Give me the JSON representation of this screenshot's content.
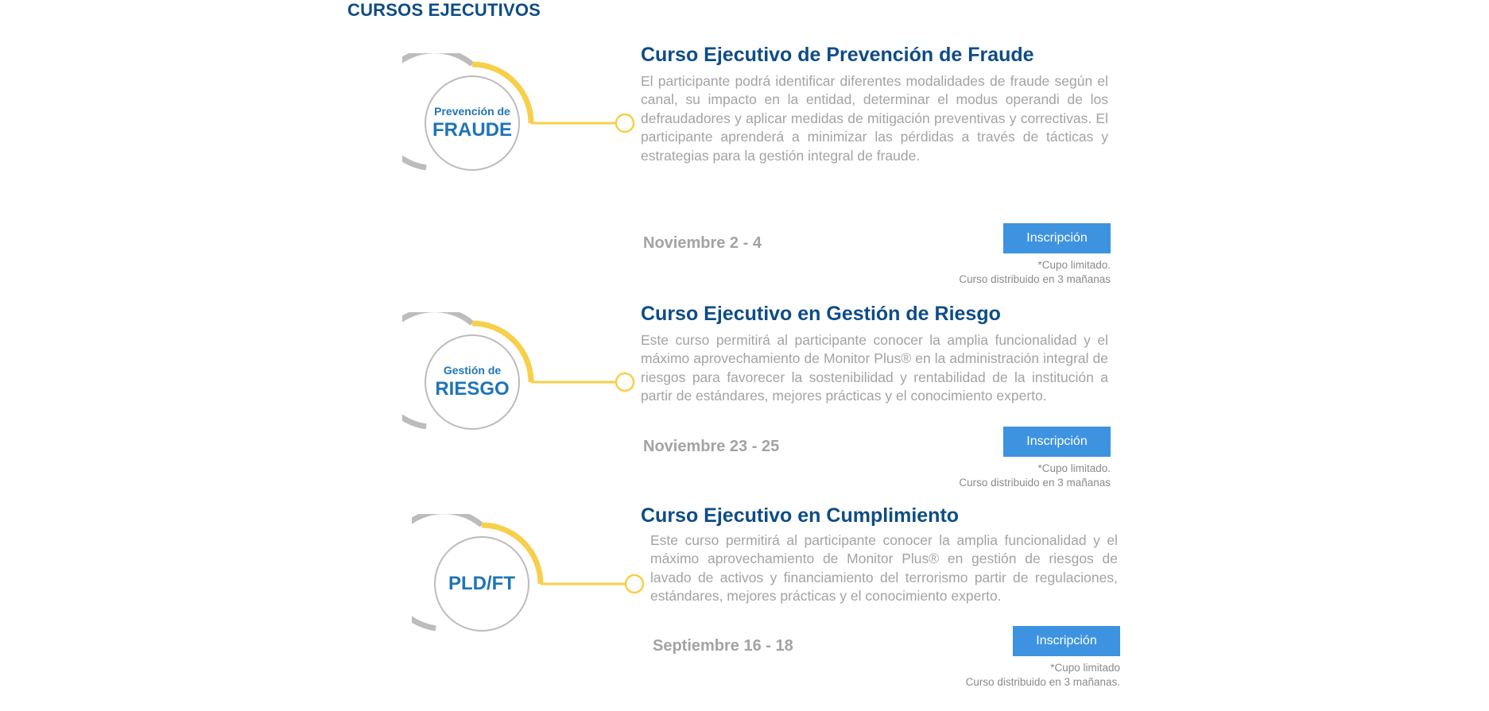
{
  "section": {
    "title": "CURSOS EJECUTIVOS"
  },
  "colors": {
    "title": "#0e4c85",
    "badge_text": "#1f74b7",
    "accent": "#f7cf4a",
    "ring": "#bcbcbc",
    "button": "#3d93e0",
    "muted": "#a3a3a3"
  },
  "courses": [
    {
      "badge_line1": "Prevención de",
      "badge_line2": "FRAUDE",
      "title": "Curso Ejecutivo de Prevención de Fraude",
      "description": "El participante podrá identificar diferentes modalidades de fraude según el canal, su impacto en la entidad, determinar el modus operandi de los defraudadores y aplicar medidas de mitigación preventivas y correctivas. El participante aprenderá a minimizar las pérdidas a través de tácticas y estrategias para la gestión integral de fraude.",
      "date": "Noviembre 2 - 4",
      "button_label": "Inscripción",
      "note_line1": "*Cupo limitado.",
      "note_line2": "Curso distribuido en 3 mañanas"
    },
    {
      "badge_line1": "Gestión de",
      "badge_line2": "RIESGO",
      "title": "Curso Ejecutivo en Gestión de Riesgo",
      "description": "Este curso permitirá al participante conocer la amplia funcionalidad y el máximo aprovechamiento de Monitor Plus® en la administración integral de riesgos para favorecer la sostenibilidad y rentabilidad de la institución a partir de estándares, mejores prácticas y el conocimiento experto.",
      "date": "Noviembre 23 - 25",
      "button_label": "Inscripción",
      "note_line1": "*Cupo limitado.",
      "note_line2": "Curso distribuido en 3 mañanas"
    },
    {
      "badge_line1": "PLD/FT",
      "title": "Curso Ejecutivo en Cumplimiento",
      "description": "Este curso permitirá al participante conocer la amplia funcionalidad y el máximo aprovechamiento de Monitor Plus® en gestión de riesgos de lavado de activos y financiamiento del terrorismo partir de regulaciones, estándares, mejores prácticas y el conocimiento experto.",
      "date": "Septiembre 16 - 18",
      "button_label": "Inscripción",
      "note_line1": "*Cupo limitado",
      "note_line2": "Curso distribuido en 3 mañanas."
    }
  ]
}
